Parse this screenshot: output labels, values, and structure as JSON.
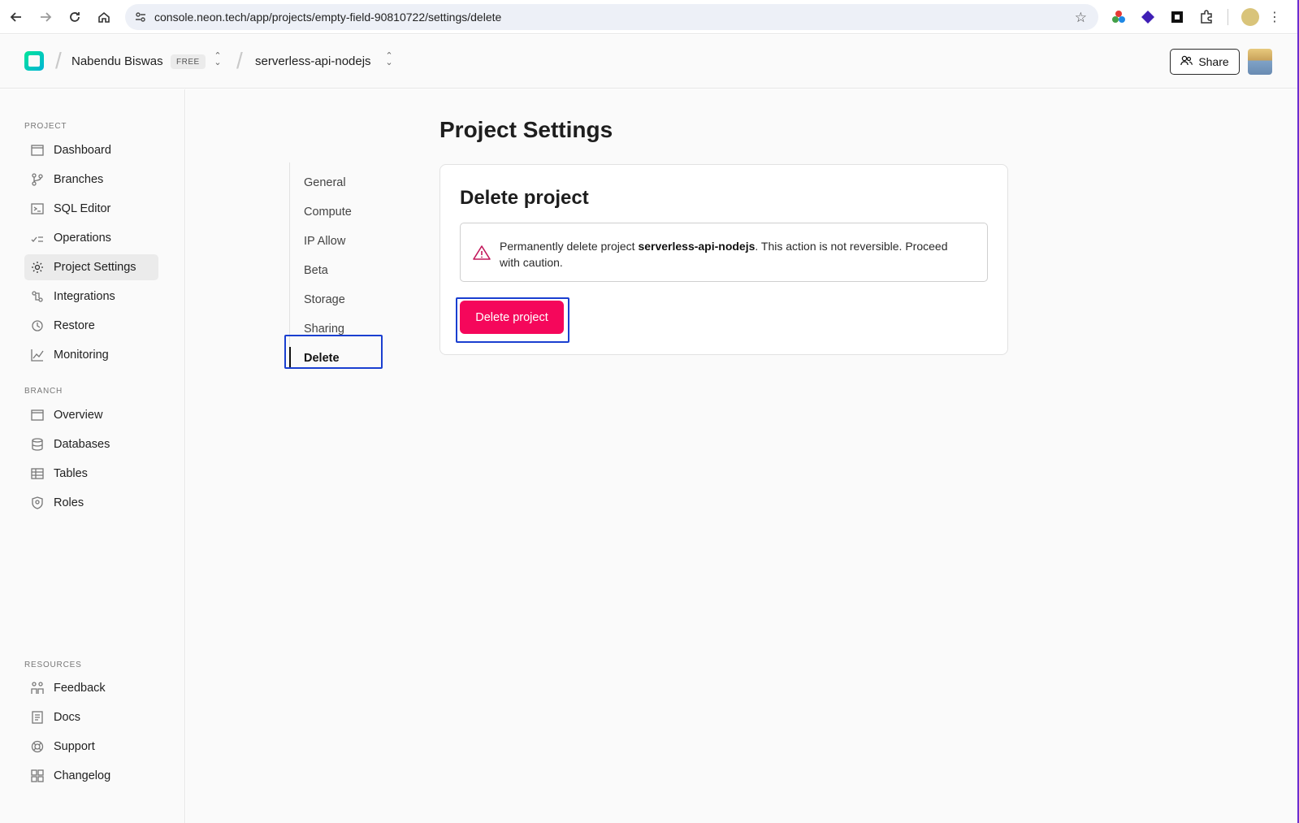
{
  "browser": {
    "url": "console.neon.tech/app/projects/empty-field-90810722/settings/delete",
    "icons": {
      "back": "back-arrow-icon",
      "forward": "forward-arrow-icon",
      "reload": "reload-icon",
      "home": "home-icon",
      "site_info": "site-info-icon",
      "bookmark": "star-icon",
      "extensions": "puzzle-icon",
      "menu": "kebab-icon"
    }
  },
  "header": {
    "org_name": "Nabendu Biswas",
    "plan_badge": "FREE",
    "project_name": "serverless-api-nodejs",
    "share_label": "Share"
  },
  "sidebar": {
    "project_label": "PROJECT",
    "project_items": [
      {
        "label": "Dashboard",
        "icon": "dashboard-icon"
      },
      {
        "label": "Branches",
        "icon": "branch-icon"
      },
      {
        "label": "SQL Editor",
        "icon": "terminal-icon"
      },
      {
        "label": "Operations",
        "icon": "operations-icon"
      },
      {
        "label": "Project Settings",
        "icon": "gear-icon",
        "active": true
      },
      {
        "label": "Integrations",
        "icon": "integrations-icon"
      },
      {
        "label": "Restore",
        "icon": "clock-icon"
      },
      {
        "label": "Monitoring",
        "icon": "chart-icon"
      }
    ],
    "branch_label": "BRANCH",
    "branch_items": [
      {
        "label": "Overview",
        "icon": "overview-icon"
      },
      {
        "label": "Databases",
        "icon": "database-icon"
      },
      {
        "label": "Tables",
        "icon": "table-icon"
      },
      {
        "label": "Roles",
        "icon": "role-icon"
      }
    ],
    "resources_label": "RESOURCES",
    "resource_items": [
      {
        "label": "Feedback",
        "icon": "feedback-icon"
      },
      {
        "label": "Docs",
        "icon": "docs-icon"
      },
      {
        "label": "Support",
        "icon": "support-icon"
      },
      {
        "label": "Changelog",
        "icon": "changelog-icon"
      }
    ]
  },
  "main": {
    "page_title": "Project Settings",
    "settings_nav": [
      "General",
      "Compute",
      "IP Allow",
      "Beta",
      "Storage",
      "Sharing",
      "Delete"
    ],
    "active_nav": "Delete",
    "card": {
      "title": "Delete project",
      "warning_prefix": "Permanently delete project ",
      "warning_project": "serverless-api-nodejs",
      "warning_suffix": ". This action is not reversible. Proceed with caution.",
      "button_label": "Delete project",
      "accent_color": "#f5075b"
    }
  }
}
